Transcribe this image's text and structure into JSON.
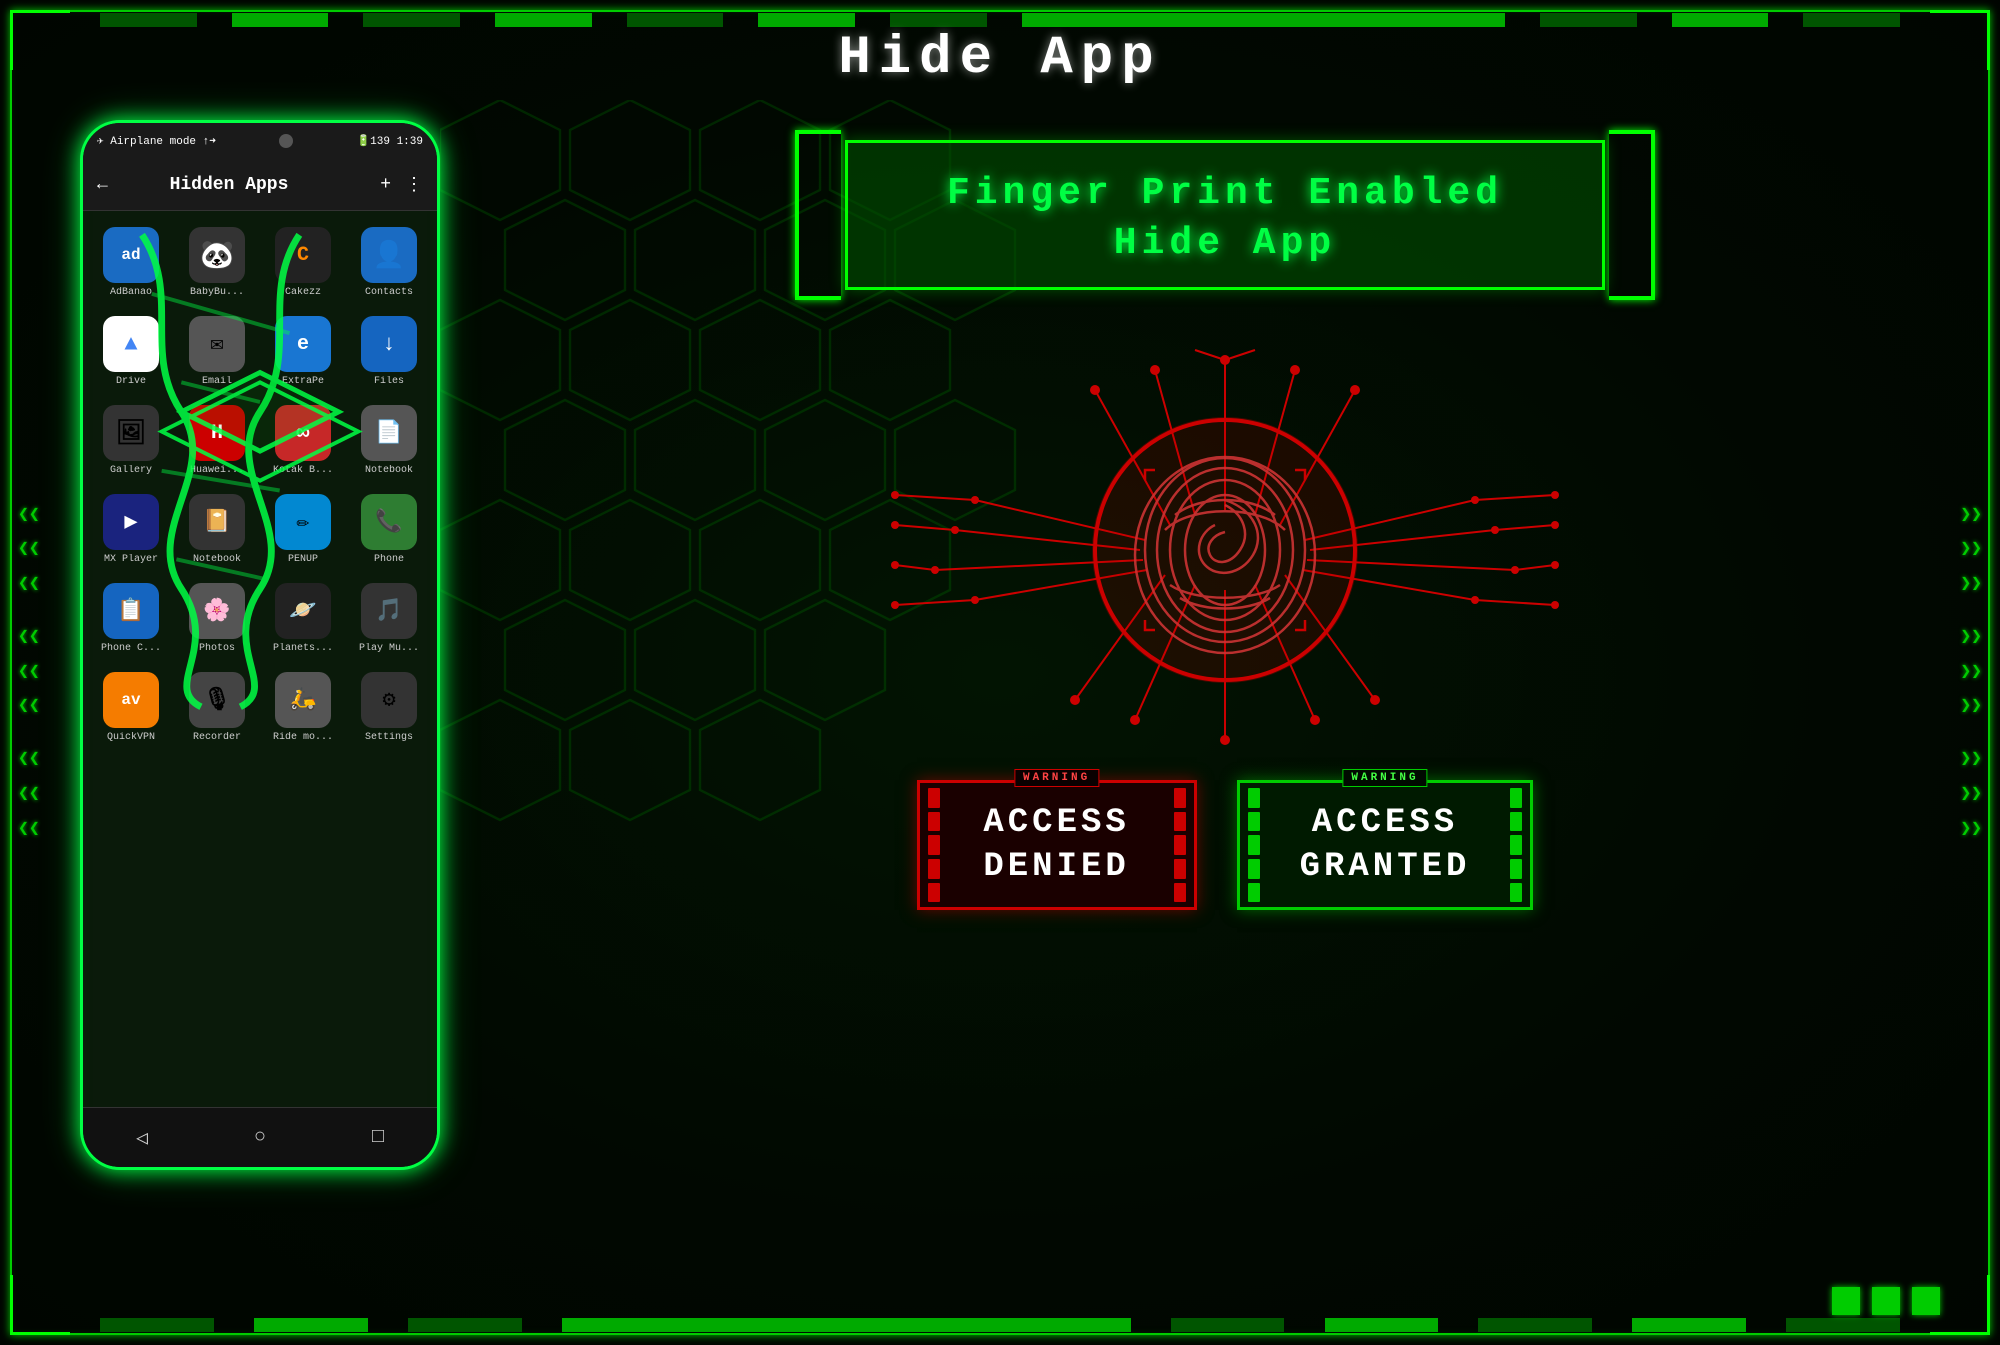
{
  "page": {
    "title": "Hide App",
    "background": "#010f01"
  },
  "phone": {
    "status_bar": {
      "left": "Airplane mode",
      "battery": "139",
      "time": "1:39"
    },
    "header": {
      "title": "Hidden Apps",
      "back_icon": "←",
      "add_icon": "+",
      "more_icon": "⋮"
    },
    "apps": [
      {
        "label": "AdBanao",
        "color": "#ffffff",
        "bg": "#1a6bc2",
        "icon": "ad"
      },
      {
        "label": "BabyBu...",
        "color": "#ffffff",
        "bg": "#333",
        "icon": "🐼"
      },
      {
        "label": "Cakezz",
        "color": "#ffffff",
        "bg": "#444",
        "icon": "C"
      },
      {
        "label": "Contacts",
        "color": "#ffffff",
        "bg": "#1a6bc2",
        "icon": "👤"
      },
      {
        "label": "Drive",
        "color": "#ffffff",
        "bg": "#2196F3",
        "icon": "▲"
      },
      {
        "label": "Email",
        "color": "#ffffff",
        "bg": "#555",
        "icon": "✉"
      },
      {
        "label": "ExtraPe",
        "color": "#ffffff",
        "bg": "#1976D2",
        "icon": "e"
      },
      {
        "label": "Files",
        "color": "#ffffff",
        "bg": "#1565C0",
        "icon": "↓"
      },
      {
        "label": "Gallery",
        "color": "#ffffff",
        "bg": "#333",
        "icon": "🖼"
      },
      {
        "label": "Huawei...",
        "color": "#ffffff",
        "bg": "#444",
        "icon": "H"
      },
      {
        "label": "Kotak B...",
        "color": "#ffffff",
        "bg": "#c62828",
        "icon": "∞"
      },
      {
        "label": "Notebook",
        "color": "#ffffff",
        "bg": "#555",
        "icon": "📄"
      },
      {
        "label": "MX Player",
        "color": "#ffffff",
        "bg": "#1a237e",
        "icon": "▶"
      },
      {
        "label": "Notebook",
        "color": "#ffffff",
        "bg": "#333",
        "icon": "📔"
      },
      {
        "label": "PENUP",
        "color": "#ffffff",
        "bg": "#444",
        "icon": "✏"
      },
      {
        "label": "Phone",
        "color": "#ffffff",
        "bg": "#2e7d32",
        "icon": "📞"
      },
      {
        "label": "Phone C...",
        "color": "#ffffff",
        "bg": "#1565C0",
        "icon": "📋"
      },
      {
        "label": "Photos",
        "color": "#ffffff",
        "bg": "#555",
        "icon": "🌸"
      },
      {
        "label": "Planets...",
        "color": "#ffffff",
        "bg": "#222",
        "icon": "🪐"
      },
      {
        "label": "Play Mu...",
        "color": "#ffffff",
        "bg": "#333",
        "icon": "🎵"
      },
      {
        "label": "QuickVPN",
        "color": "#ffffff",
        "bg": "#f57c00",
        "icon": "av"
      },
      {
        "label": "Recorder",
        "color": "#ffffff",
        "bg": "#444",
        "icon": "🎙"
      },
      {
        "label": "Ride mo...",
        "color": "#ffffff",
        "bg": "#555",
        "icon": "🛵"
      },
      {
        "label": "Settings",
        "color": "#ffffff",
        "bg": "#333",
        "icon": "⚙"
      }
    ],
    "nav": [
      "◁",
      "○",
      "□"
    ]
  },
  "right_panel": {
    "fp_title_line1": "Finger Print Enabled",
    "fp_title_line2": "Hide App",
    "access_denied": {
      "warning": "WARNING",
      "text_line1": "ACCESS",
      "text_line2": "DENIED"
    },
    "access_granted": {
      "warning": "WARNING",
      "text_line1": "ACCESS",
      "text_line2": "GRANTED"
    }
  },
  "decorations": {
    "left_arrows": [
      "❮❮",
      "❮❮",
      "❮❮",
      "❮❮",
      "❮❮"
    ],
    "right_arrows": [
      "❯❯",
      "❯❯",
      "❯❯",
      "❯❯",
      "❯❯"
    ]
  }
}
